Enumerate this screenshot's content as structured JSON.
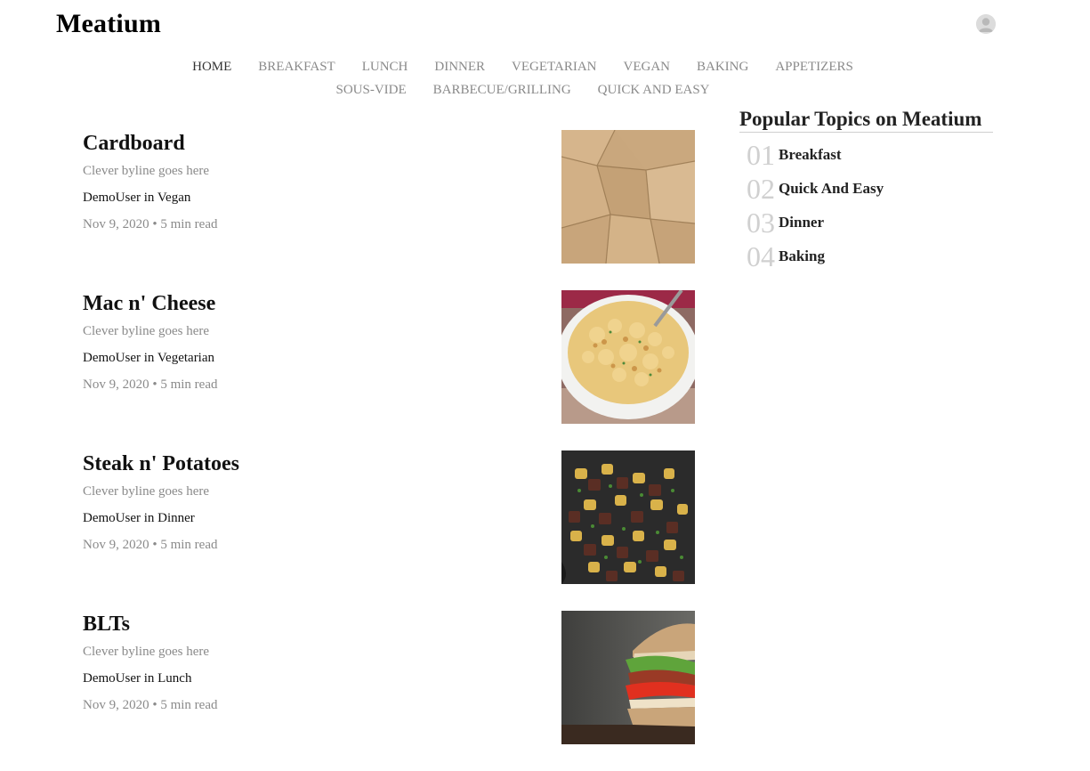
{
  "header": {
    "logo": "Meatium"
  },
  "nav": {
    "row1": [
      "HOME",
      "BREAKFAST",
      "LUNCH",
      "DINNER",
      "VEGETARIAN",
      "VEGAN",
      "BAKING",
      "APPETIZERS"
    ],
    "row2": [
      "SOUS-VIDE",
      "BARBECUE/GRILLING",
      "QUICK AND EASY"
    ],
    "active": "HOME"
  },
  "articles": [
    {
      "title": "Cardboard",
      "byline": "Clever byline goes here",
      "author": "DemoUser in Vegan",
      "meta": "Nov 9, 2020 • 5 min read",
      "image": "cardboard"
    },
    {
      "title": "Mac n' Cheese",
      "byline": "Clever byline goes here",
      "author": "DemoUser in Vegetarian",
      "meta": "Nov 9, 2020 • 5 min read",
      "image": "mac-and-cheese"
    },
    {
      "title": "Steak n' Potatoes",
      "byline": "Clever byline goes here",
      "author": "DemoUser in Dinner",
      "meta": "Nov 9, 2020 • 5 min read",
      "image": "steak-and-potatoes"
    },
    {
      "title": "BLTs",
      "byline": "Clever byline goes here",
      "author": "DemoUser in Lunch",
      "meta": "Nov 9, 2020 • 5 min read",
      "image": "blt-sandwich"
    }
  ],
  "popular": {
    "title": "Popular Topics on Meatium",
    "topics": [
      {
        "num": "01",
        "name": "Breakfast"
      },
      {
        "num": "02",
        "name": "Quick And Easy"
      },
      {
        "num": "03",
        "name": "Dinner"
      },
      {
        "num": "04",
        "name": "Baking"
      }
    ]
  },
  "icons": {
    "avatar": "user-avatar-icon"
  }
}
